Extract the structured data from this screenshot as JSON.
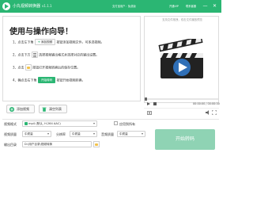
{
  "titlebar": {
    "title": "小丸视频转换器",
    "version": "v1.1.1",
    "info": "支付宝用户：免费版",
    "vip_label": "开通VIP",
    "contact_label": "联系客服",
    "min_label": "—",
    "close_label": "✕"
  },
  "guide": {
    "title": "使用与操作向导！",
    "steps": [
      {
        "n": "1、点击左下角",
        "chip": "添加视频",
        "desc": "按钮添加视频文件，可多选视频。"
      },
      {
        "n": "2、点击下方",
        "desc": "选择视频输出格式并选择对应的输出设置。"
      },
      {
        "n": "3、点击",
        "desc": "按钮打开视频转换后的保存位置。"
      },
      {
        "n": "4、确点击右下角",
        "chip": "开始转码",
        "desc": "按钮开始视频转换。"
      }
    ]
  },
  "preview": {
    "hint_line1": "支持文件拖拽，双击文件播放预览",
    "hint_line2": "",
    "time": "00:00:00 / 00:00:00"
  },
  "actions": {
    "add_label": "添加视频",
    "clear_label": "清空列表"
  },
  "settings": {
    "format_label": "视频格式",
    "format_value": "mp4 (默认, H.264 AAC)",
    "apply_all_label": "应用到所有",
    "quality_label": "视频质量",
    "quality_value": "中质量",
    "resolution_label": "分辨率",
    "resolution_value": "中质量",
    "audio_label": "音频质量",
    "audio_value": "中质量",
    "output_label": "输出目录",
    "output_value": "D:\\用户目录\\视频转换",
    "start_label": "开始转码"
  },
  "colors": {
    "accent": "#2bb673",
    "start_disabled": "#8fd3b4"
  }
}
